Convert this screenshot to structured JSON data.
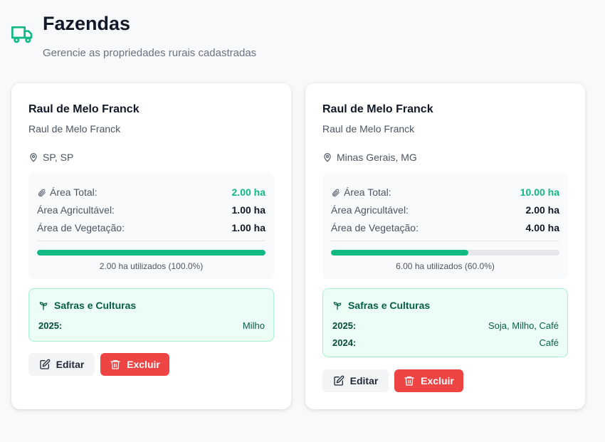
{
  "header": {
    "title": "Fazendas",
    "subtitle": "Gerencie as propriedades rurais cadastradas",
    "icon": "truck-icon"
  },
  "colors": {
    "accent": "#10b981",
    "danger": "#ef4444",
    "crops_bg": "#ecfdf5"
  },
  "labels": {
    "total_area": "Área Total:",
    "agri_area": "Área Agricultável:",
    "veg_area": "Área de Vegetação:",
    "crops_title": "Safras e Culturas",
    "edit": "Editar",
    "delete": "Excluir"
  },
  "farms": [
    {
      "name": "Raul de Melo Franck",
      "owner": "Raul de Melo Franck",
      "location": "SP, SP",
      "total_area": "2.00 ha",
      "agri_area": "1.00 ha",
      "veg_area": "1.00 ha",
      "usage_fraction": 1.0,
      "usage_caption": "2.00 ha utilizados (100.0%)",
      "crops": [
        {
          "year": "2025:",
          "cultures": "Milho"
        }
      ]
    },
    {
      "name": "Raul de Melo Franck",
      "owner": "Raul de Melo Franck",
      "location": "Minas Gerais, MG",
      "total_area": "10.00 ha",
      "agri_area": "2.00 ha",
      "veg_area": "4.00 ha",
      "usage_fraction": 0.6,
      "usage_caption": "6.00 ha utilizados (60.0%)",
      "crops": [
        {
          "year": "2025:",
          "cultures": "Soja, Milho, Café"
        },
        {
          "year": "2024:",
          "cultures": "Café"
        }
      ]
    }
  ]
}
